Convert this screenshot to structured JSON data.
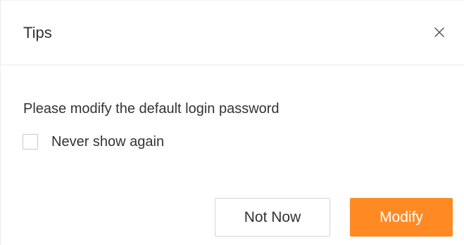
{
  "dialog": {
    "title": "Tips",
    "message": "Please modify the default login password",
    "never_show_again": {
      "label": "Never show again",
      "checked": false
    },
    "buttons": {
      "not_now_label": "Not Now",
      "modify_label": "Modify"
    },
    "icons": {
      "close": "close-icon"
    },
    "colors": {
      "accent": "#ff8a24",
      "text": "#333333"
    }
  }
}
